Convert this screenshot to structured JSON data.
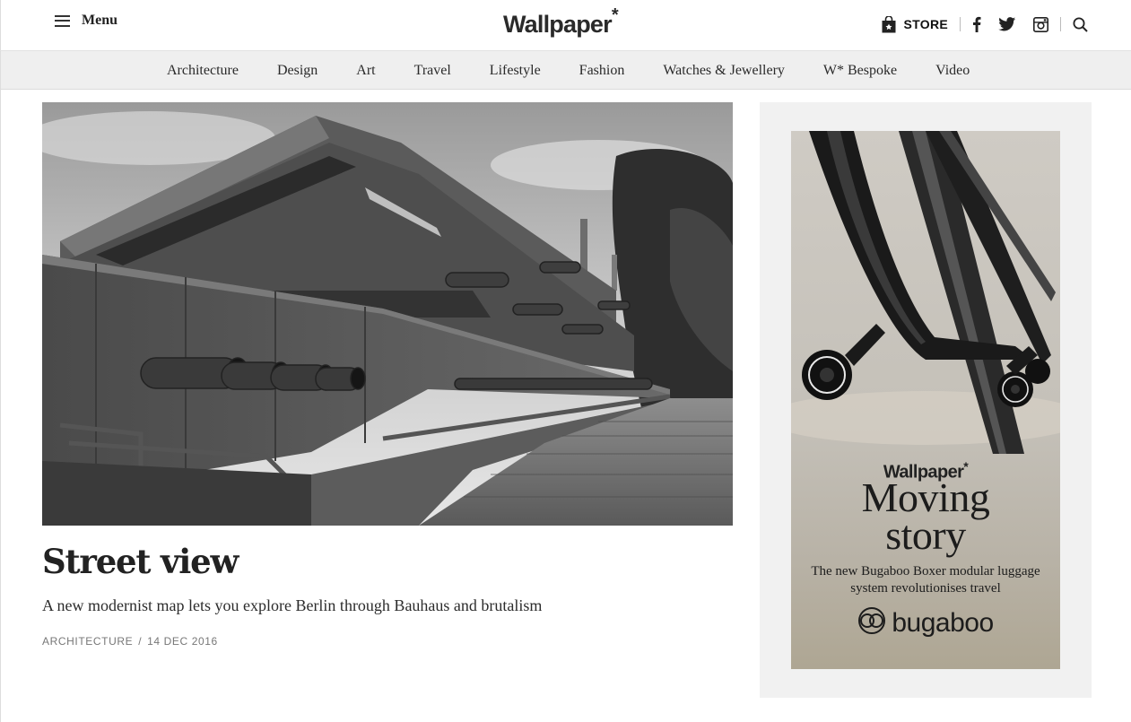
{
  "header": {
    "menu_label": "Menu",
    "logo_text": "Wallpaper",
    "logo_mark": "*",
    "store_label": "STORE",
    "icons": [
      "hamburger-icon",
      "shopping-bag-icon",
      "facebook-icon",
      "twitter-icon",
      "instagram-icon",
      "search-icon"
    ]
  },
  "nav": {
    "items": [
      "Architecture",
      "Design",
      "Art",
      "Travel",
      "Lifestyle",
      "Fashion",
      "Watches & Jewellery",
      "W* Bespoke",
      "Video"
    ]
  },
  "article": {
    "image_alt": "Black and white photograph of a brutalist concrete building with protruding pipes",
    "title": "Street view",
    "standfirst": "A new modernist map lets you explore Berlin through Bauhaus and brutalism",
    "category": "ARCHITECTURE",
    "divider": "/",
    "date": "14 DEC 2016"
  },
  "ad": {
    "logo": "Wallpaper",
    "logo_mark": "*",
    "headline_line1": "Moving",
    "headline_line2": "story",
    "copy": "The new Bugaboo Boxer modular luggage system revolutionises travel",
    "brand": "bugaboo"
  },
  "colors": {
    "nav_background": "#efefef",
    "ad_panel_background": "#f1f1f1",
    "meta_text": "#777777"
  }
}
